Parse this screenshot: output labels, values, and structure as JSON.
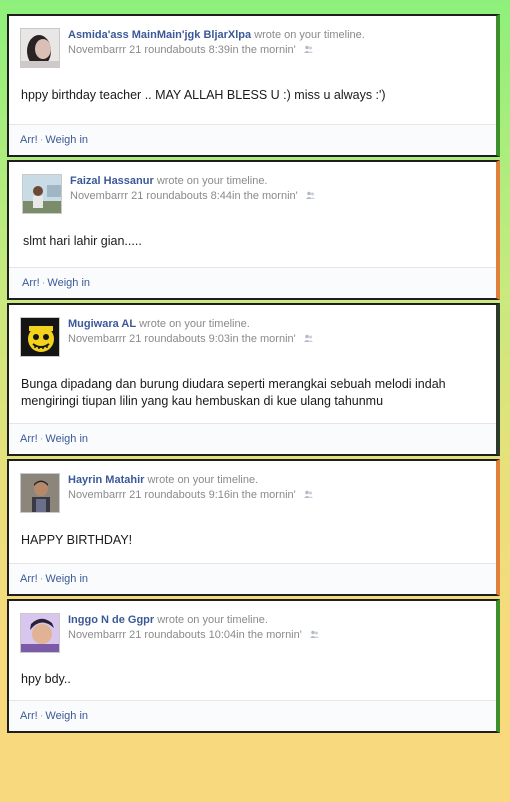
{
  "feed": {
    "wrote_text": "wrote on your timeline.",
    "action_like": "Arr!",
    "action_comment": "Weigh in",
    "posts": [
      {
        "author": "Asmida'ass MainMain'jgk BljarXlpa",
        "time": "Novembarrr 21 roundabouts 8:39in the mornin'",
        "message": "hppy birthday teacher .. MAY ALLAH BLESS U :) miss u always :')",
        "avatar_icon": "user-photo-icon"
      },
      {
        "author": "Faizal Hassanur",
        "time": "Novembarrr 21 roundabouts 8:44in the mornin'",
        "message": "slmt hari lahir gian.....",
        "avatar_icon": "user-photo-icon"
      },
      {
        "author": "Mugiwara AL",
        "time": "Novembarrr 21 roundabouts 9:03in the mornin'",
        "message": "Bunga dipadang dan burung diudara seperti merangkai sebuah melodi indah mengiringi tiupan lilin yang kau hembuskan di kue ulang tahunmu",
        "avatar_icon": "jolly-roger-icon"
      },
      {
        "author": "Hayrin Matahir",
        "time": "Novembarrr 21 roundabouts 9:16in the mornin'",
        "message": "HAPPY BIRTHDAY!",
        "avatar_icon": "user-photo-icon"
      },
      {
        "author": "Inggo N de Ggpr",
        "time": "Novembarrr 21 roundabouts 10:04in the mornin'",
        "message": "hpy bdy..",
        "avatar_icon": "user-photo-icon"
      }
    ]
  }
}
